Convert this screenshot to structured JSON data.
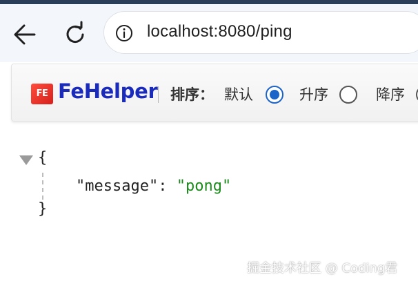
{
  "browser": {
    "url": "localhost:8080/ping"
  },
  "fehelper": {
    "logo_text": "FE",
    "title": "FeHelper",
    "sort_label": "排序：",
    "sort_options": [
      {
        "label": "默认",
        "selected": true
      },
      {
        "label": "升序",
        "selected": false
      },
      {
        "label": "降序",
        "selected": false
      }
    ]
  },
  "json_view": {
    "open_brace": "{",
    "close_brace": "}",
    "entries": [
      {
        "key": "\"message\"",
        "colon": ":",
        "value": "\"pong\""
      }
    ]
  },
  "watermark": "掘金技术社区 @ Coding君",
  "colors": {
    "fehelper_title": "#1a2bbb",
    "radio_selected": "#1d64c8",
    "json_string": "#1a8a1a"
  },
  "icons": [
    "back-arrow-icon",
    "reload-icon",
    "info-icon",
    "collapse-triangle-icon"
  ]
}
